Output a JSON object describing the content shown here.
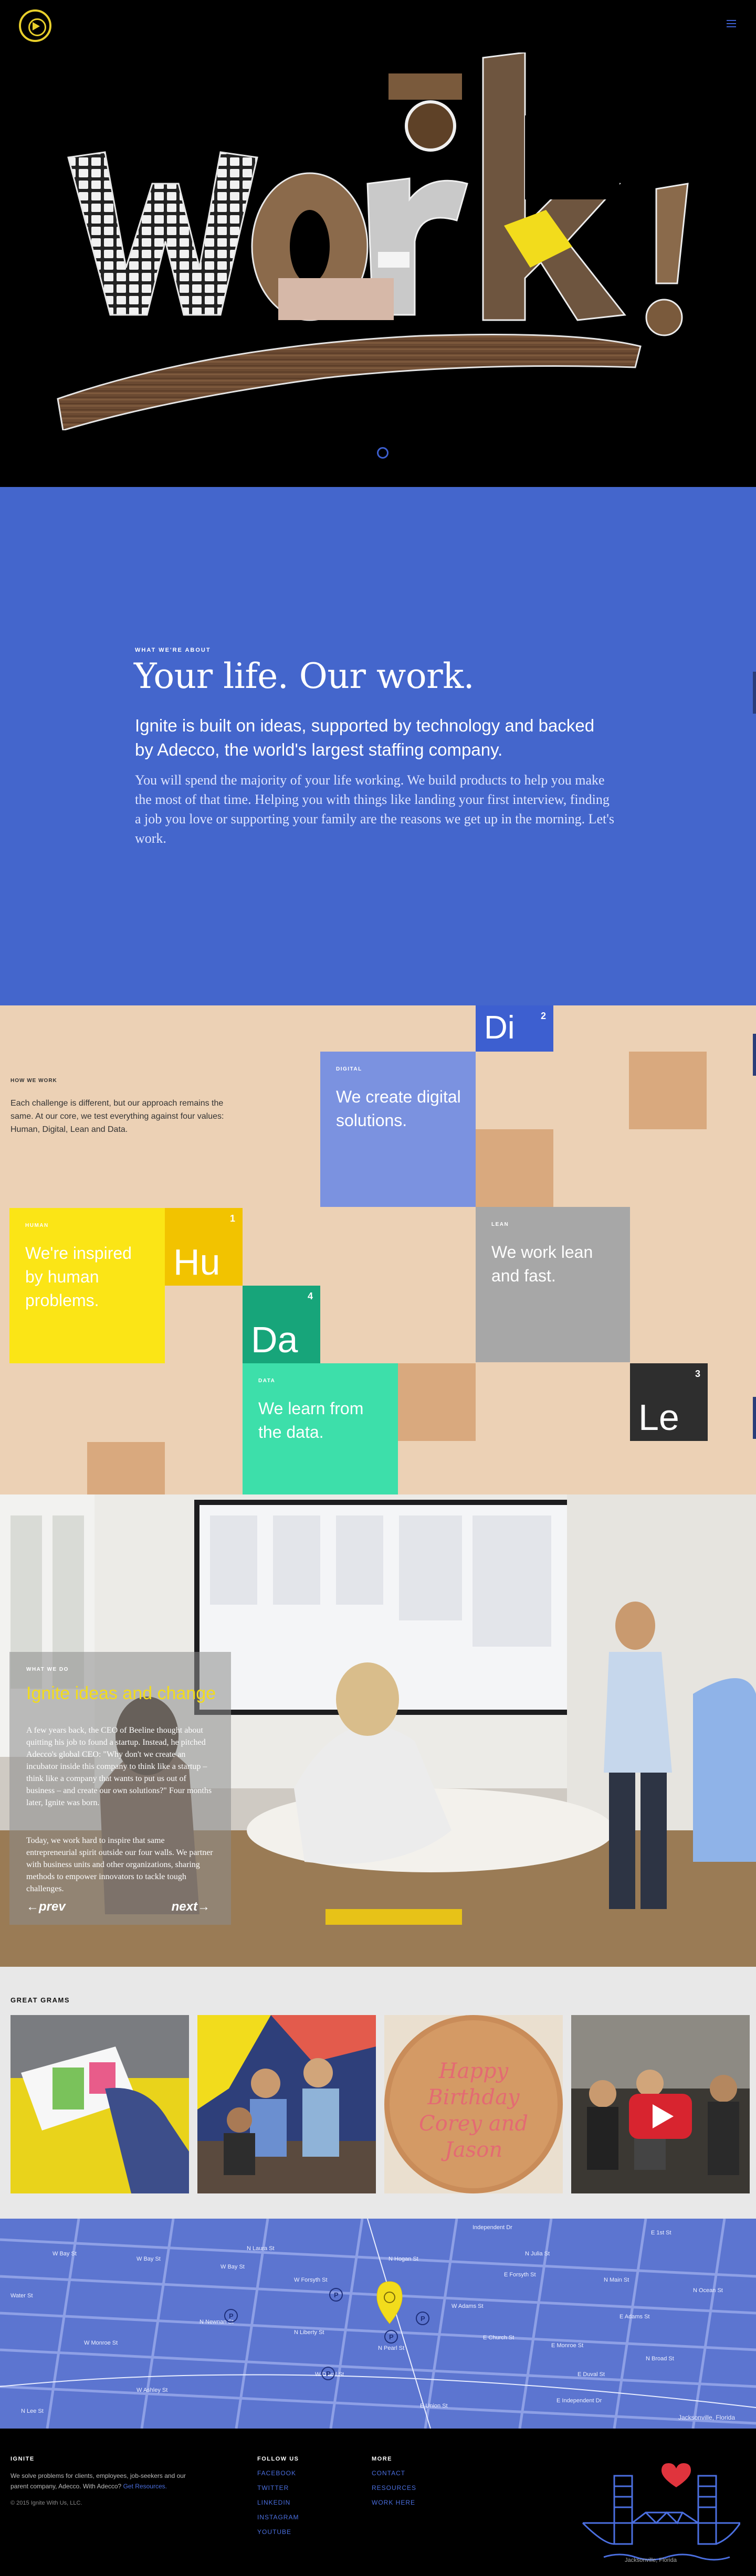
{
  "header": {
    "logo_icon": "ignite-logo-icon",
    "menu_icon": "hamburger-menu-icon",
    "hero_word": "work"
  },
  "about": {
    "eyebrow": "WHAT WE'RE ABOUT",
    "title": "Your life. Our work.",
    "lead": "Ignite is built on ideas, supported by technology and backed by Adecco, the world's largest staffing company.",
    "body": "You will spend the majority of your life working. We build products to help you make the most of that time. Helping you with things like landing your first interview, finding a job you love or supporting your family are the reasons we get up in the morning. Let's work."
  },
  "how": {
    "eyebrow": "HOW WE WORK",
    "intro": "Each challenge is different, but our approach remains the same. At our core, we test everything against four values: Human, Digital, Lean and Data.",
    "elements": [
      {
        "symbol": "Di",
        "number": "2",
        "label": "DIGITAL",
        "text": "We create digital solutions."
      },
      {
        "symbol": "Hu",
        "number": "1",
        "label": "HUMAN",
        "text": "We're inspired by human problems."
      },
      {
        "symbol": "Le",
        "number": "3",
        "label": "LEAN",
        "text": "We work lean and fast."
      },
      {
        "symbol": "Da",
        "number": "4",
        "label": "DATA",
        "text": "We learn from the data."
      }
    ]
  },
  "story": {
    "eyebrow": "WHAT WE DO",
    "title": "Ignite ideas and change",
    "p1": "A few years back, the CEO of Beeline thought about quitting his job to found a startup. Instead, he pitched Adecco's global CEO: \"Why don't we create an incubator inside this company to think like a startup – think like a company that wants to put us out of business – and create our own solutions?\" Four months later, Ignite was born.",
    "p2": "Today, we work hard to inspire that same entrepreneurial spirit outside our four walls. We partner with business units and other organizations, sharing methods to empower innovators to tackle tough challenges.",
    "prev": "←prev",
    "next": "next→"
  },
  "grams": {
    "eyebrow": "GREAT GRAMS",
    "items": [
      {
        "name": "gram-desk",
        "icon": "photo-icon"
      },
      {
        "name": "gram-team",
        "icon": "photo-icon"
      },
      {
        "name": "gram-cookie",
        "icon": "photo-icon",
        "cookie_text": "Happy Birthday Corey and Jason"
      },
      {
        "name": "gram-video",
        "icon": "play-video-icon"
      }
    ]
  },
  "map": {
    "caption": "Jacksonville, Florida",
    "pin_icon": "ignite-map-pin-icon",
    "parking_icon": "parking-icon",
    "streets": [
      "W Bay St",
      "W Bay St",
      "W Bay St",
      "N Laura St",
      "N Hogan St",
      "N Julia St",
      "N Main St",
      "N Ocean St",
      "E Forsyth St",
      "W Forsyth St",
      "W Adams St",
      "E Adams St",
      "E Monroe St",
      "W Monroe St",
      "N Pearl St",
      "W Duval St",
      "E Duval St",
      "W Ashley St",
      "E Union St",
      "E 1st St",
      "Independent Dr",
      "E Independent Dr",
      "Water St",
      "N Newnan St",
      "N Liberty St",
      "E Church St",
      "N Broad St",
      "N Lee St"
    ]
  },
  "footer": {
    "about_title": "IGNITE",
    "about_text": "We solve problems for clients, employees, job-seekers and our parent company, Adecco. With Adecco?",
    "about_link": "Get Resources.",
    "copyright": "© 2015 Ignite With Us, LLC.",
    "follow_title": "FOLLOW US",
    "follow_links": [
      "FACEBOOK",
      "TWITTER",
      "LINKEDIN",
      "INSTAGRAM",
      "YOUTUBE"
    ],
    "more_title": "MORE",
    "more_links": [
      "CONTACT",
      "RESOURCES",
      "WORK HERE"
    ],
    "bridge_caption": "Jacksonville, Florida",
    "bridge_icon": "main-street-bridge-icon",
    "heart_icon": "heart-icon"
  },
  "colors": {
    "accent_yellow": "#f2dc1c",
    "brand_blue": "#4466cc",
    "tan": "#ecd1b5",
    "digital_blue": "#7b92e0",
    "lean_gray": "#a7a7a7",
    "data_teal": "#3ddfaa",
    "dark_tile": "#2e2e2e"
  }
}
